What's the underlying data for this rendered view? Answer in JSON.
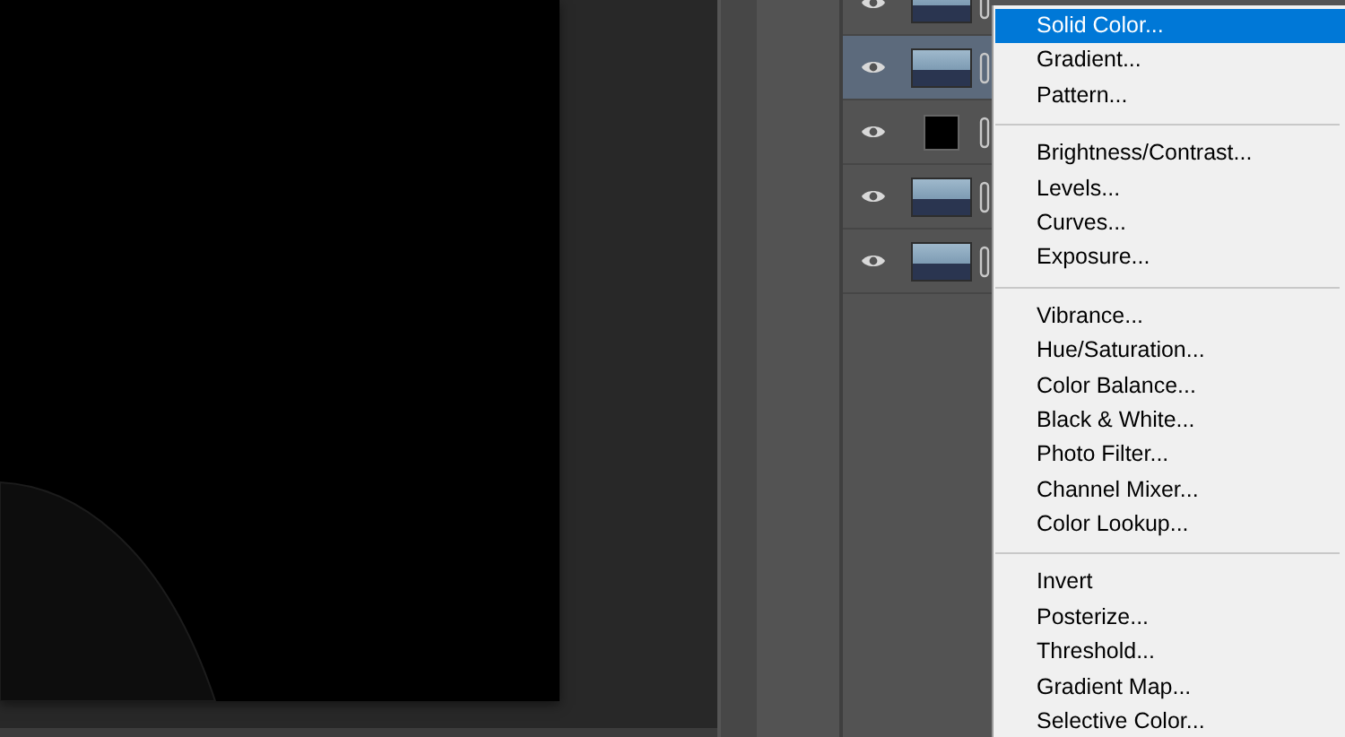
{
  "layers": [
    {
      "kind": "photo",
      "visible": true,
      "selected": false
    },
    {
      "kind": "photo",
      "visible": true,
      "selected": true
    },
    {
      "kind": "fill",
      "visible": true,
      "selected": false
    },
    {
      "kind": "photo",
      "visible": true,
      "selected": false
    },
    {
      "kind": "photo",
      "visible": true,
      "selected": false
    }
  ],
  "menu": {
    "sections": [
      {
        "items": [
          {
            "label": "Solid Color...",
            "selected": true
          },
          {
            "label": "Gradient...",
            "selected": false
          },
          {
            "label": "Pattern...",
            "selected": false
          }
        ]
      },
      {
        "items": [
          {
            "label": "Brightness/Contrast...",
            "selected": false
          },
          {
            "label": "Levels...",
            "selected": false
          },
          {
            "label": "Curves...",
            "selected": false
          },
          {
            "label": "Exposure...",
            "selected": false
          }
        ]
      },
      {
        "items": [
          {
            "label": "Vibrance...",
            "selected": false
          },
          {
            "label": "Hue/Saturation...",
            "selected": false
          },
          {
            "label": "Color Balance...",
            "selected": false
          },
          {
            "label": "Black & White...",
            "selected": false
          },
          {
            "label": "Photo Filter...",
            "selected": false
          },
          {
            "label": "Channel Mixer...",
            "selected": false
          },
          {
            "label": "Color Lookup...",
            "selected": false
          }
        ]
      },
      {
        "items": [
          {
            "label": "Invert",
            "selected": false
          },
          {
            "label": "Posterize...",
            "selected": false
          },
          {
            "label": "Threshold...",
            "selected": false
          },
          {
            "label": "Gradient Map...",
            "selected": false
          },
          {
            "label": "Selective Color...",
            "selected": false
          }
        ]
      }
    ]
  }
}
